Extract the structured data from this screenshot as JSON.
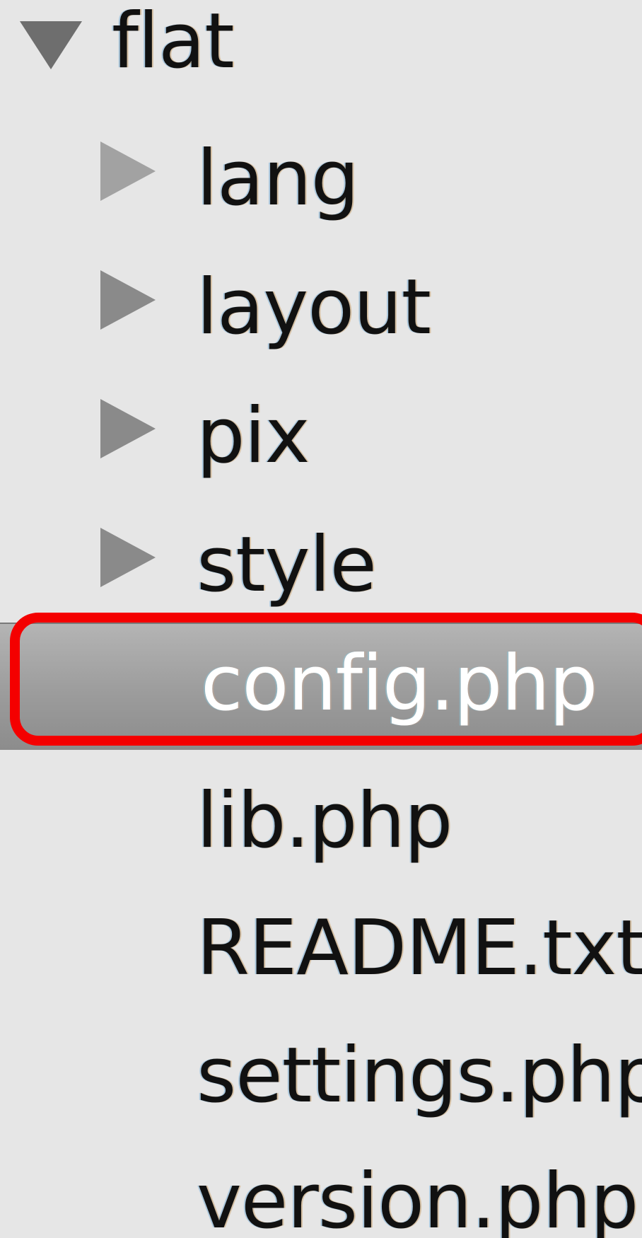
{
  "tree": {
    "root": {
      "label": "flat",
      "icon": "triangle-down-icon",
      "expanded": true
    },
    "folders": [
      {
        "label": "lang",
        "icon": "triangle-right-icon"
      },
      {
        "label": "layout",
        "icon": "triangle-right-icon"
      },
      {
        "label": "pix",
        "icon": "triangle-right-icon"
      },
      {
        "label": "style",
        "icon": "triangle-right-icon"
      }
    ],
    "files": [
      {
        "label": "config.php",
        "selected": true
      },
      {
        "label": "lib.php"
      },
      {
        "label": "README.txt"
      },
      {
        "label": "settings.php"
      },
      {
        "label": "version.php"
      }
    ]
  },
  "colors": {
    "background": "#e6e6e6",
    "selection": "#9c9c9c",
    "highlight_box": "#f40000"
  }
}
